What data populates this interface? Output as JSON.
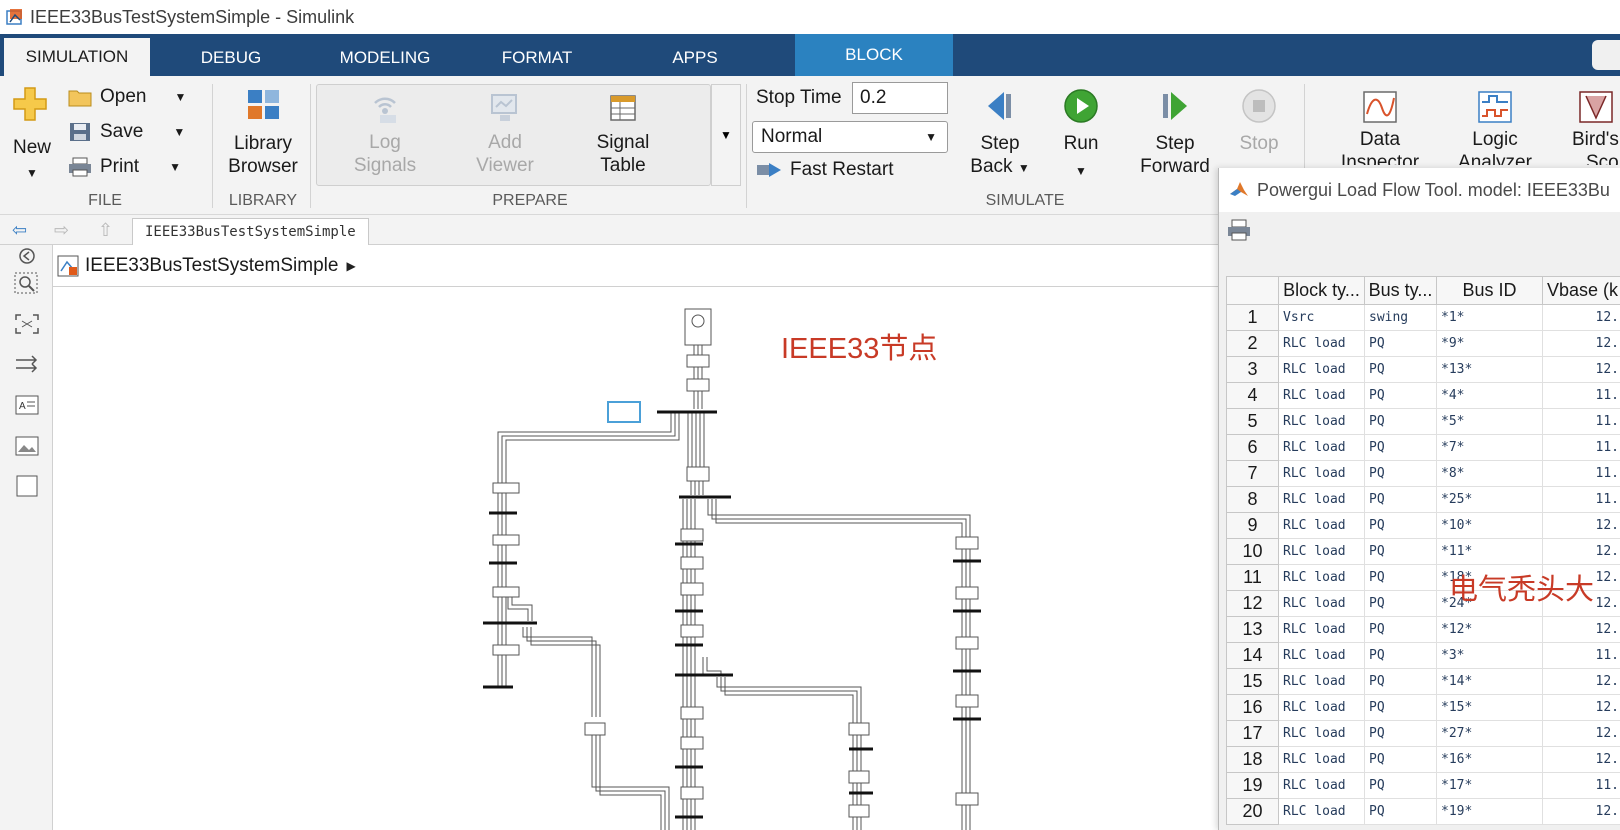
{
  "window": {
    "title": "IEEE33BusTestSystemSimple - Simulink"
  },
  "tabs": [
    "SIMULATION",
    "DEBUG",
    "MODELING",
    "FORMAT",
    "APPS",
    "BLOCK"
  ],
  "ribbon": {
    "file": {
      "new": "New",
      "open": "Open",
      "save": "Save",
      "print": "Print",
      "label": "FILE"
    },
    "library": {
      "browser_line1": "Library",
      "browser_line2": "Browser",
      "label": "LIBRARY"
    },
    "prepare": {
      "log_line1": "Log",
      "log_line2": "Signals",
      "add_line1": "Add",
      "add_line2": "Viewer",
      "table_line1": "Signal",
      "table_line2": "Table",
      "label": "PREPARE"
    },
    "simulate": {
      "stop_time_label": "Stop Time",
      "stop_time_value": "0.2",
      "mode": "Normal",
      "fast_restart": "Fast Restart",
      "step_back_line1": "Step",
      "step_back_line2": "Back",
      "run": "Run",
      "step_fwd_line1": "Step",
      "step_fwd_line2": "Forward",
      "stop": "Stop",
      "label": "SIMULATE"
    },
    "review": {
      "data_line1": "Data",
      "data_line2": "Inspector",
      "logic_line1": "Logic",
      "logic_line2": "Analyzer",
      "birds_line1": "Bird's",
      "birds_line2": "Sco"
    }
  },
  "nav": {
    "breadcrumb": "IEEE33BusTestSystemSimple"
  },
  "model": {
    "name": "IEEE33BusTestSystemSimple",
    "annotation": "IEEE33节点"
  },
  "dialog": {
    "title": "Powergui Load Flow Tool. model: IEEE33Bu",
    "columns": [
      "Block ty...",
      "Bus ty...",
      "Bus ID",
      "Vbase (k"
    ],
    "rows": [
      {
        "n": "1",
        "type": "Vsrc",
        "bus_type": "swing",
        "bus_id": "*1*",
        "vbase": "12."
      },
      {
        "n": "2",
        "type": "RLC load",
        "bus_type": "PQ",
        "bus_id": "*9*",
        "vbase": "12."
      },
      {
        "n": "3",
        "type": "RLC load",
        "bus_type": "PQ",
        "bus_id": "*13*",
        "vbase": "12."
      },
      {
        "n": "4",
        "type": "RLC load",
        "bus_type": "PQ",
        "bus_id": "*4*",
        "vbase": "11."
      },
      {
        "n": "5",
        "type": "RLC load",
        "bus_type": "PQ",
        "bus_id": "*5*",
        "vbase": "11."
      },
      {
        "n": "6",
        "type": "RLC load",
        "bus_type": "PQ",
        "bus_id": "*7*",
        "vbase": "11."
      },
      {
        "n": "7",
        "type": "RLC load",
        "bus_type": "PQ",
        "bus_id": "*8*",
        "vbase": "11."
      },
      {
        "n": "8",
        "type": "RLC load",
        "bus_type": "PQ",
        "bus_id": "*25*",
        "vbase": "11."
      },
      {
        "n": "9",
        "type": "RLC load",
        "bus_type": "PQ",
        "bus_id": "*10*",
        "vbase": "12."
      },
      {
        "n": "10",
        "type": "RLC load",
        "bus_type": "PQ",
        "bus_id": "*11*",
        "vbase": "12."
      },
      {
        "n": "11",
        "type": "RLC load",
        "bus_type": "PQ",
        "bus_id": "*18*",
        "vbase": "12."
      },
      {
        "n": "12",
        "type": "RLC load",
        "bus_type": "PQ",
        "bus_id": "*24*",
        "vbase": "12."
      },
      {
        "n": "13",
        "type": "RLC load",
        "bus_type": "PQ",
        "bus_id": "*12*",
        "vbase": "12."
      },
      {
        "n": "14",
        "type": "RLC load",
        "bus_type": "PQ",
        "bus_id": "*3*",
        "vbase": "11."
      },
      {
        "n": "15",
        "type": "RLC load",
        "bus_type": "PQ",
        "bus_id": "*14*",
        "vbase": "12."
      },
      {
        "n": "16",
        "type": "RLC load",
        "bus_type": "PQ",
        "bus_id": "*15*",
        "vbase": "12."
      },
      {
        "n": "17",
        "type": "RLC load",
        "bus_type": "PQ",
        "bus_id": "*27*",
        "vbase": "12."
      },
      {
        "n": "18",
        "type": "RLC load",
        "bus_type": "PQ",
        "bus_id": "*16*",
        "vbase": "12."
      },
      {
        "n": "19",
        "type": "RLC load",
        "bus_type": "PQ",
        "bus_id": "*17*",
        "vbase": "11."
      },
      {
        "n": "20",
        "type": "RLC load",
        "bus_type": "PQ",
        "bus_id": "*19*",
        "vbase": "12."
      }
    ],
    "watermark": "电气秃头大"
  },
  "colors": {
    "tab_bar": "#1f4a7a",
    "block_tab": "#2b82c0",
    "annotation": "#c83a26"
  }
}
